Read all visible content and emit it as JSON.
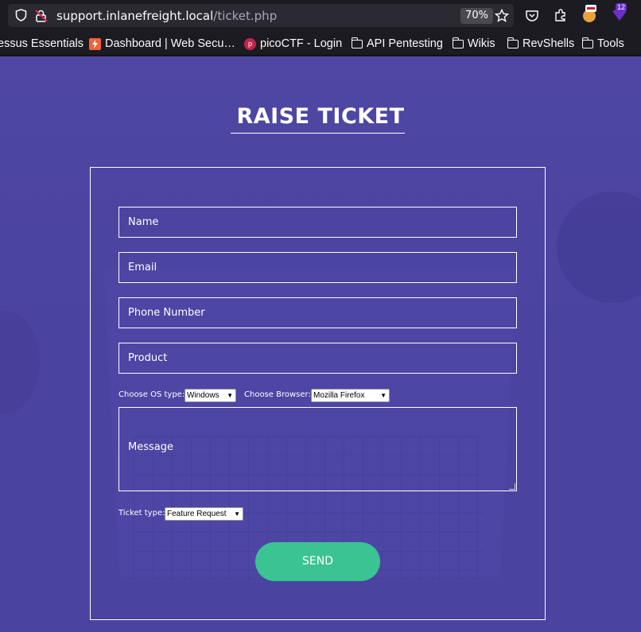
{
  "browser": {
    "url_host": "support.inlanefreight.local",
    "url_path": "/ticket.php",
    "zoom": "70%",
    "badge_count": "12"
  },
  "bookmarks": [
    {
      "label": "essus Essentials",
      "icon": "none"
    },
    {
      "label": "Dashboard | Web Secu…",
      "icon": "lightning-icon"
    },
    {
      "label": "picoCTF - Login",
      "icon": "picoctf-icon"
    },
    {
      "label": "API Pentesting",
      "icon": "folder-icon"
    },
    {
      "label": "Wikis",
      "icon": "folder-icon"
    },
    {
      "label": "RevShells",
      "icon": "folder-icon"
    },
    {
      "label": "Tools",
      "icon": "folder-icon"
    }
  ],
  "form": {
    "title": "RAISE TICKET",
    "name_placeholder": "Name",
    "email_placeholder": "Email",
    "phone_placeholder": "Phone Number",
    "product_placeholder": "Product",
    "os_label": "Choose OS type:",
    "os_value": "Windows",
    "browser_label": "Choose Browser:",
    "browser_value": "Mozilla Firefox",
    "message_placeholder": "Message",
    "ticket_type_label": "Ticket type:",
    "ticket_type_value": "Feature Request",
    "send_label": "SEND"
  },
  "colors": {
    "page_bg": "#4b44a0",
    "send_button": "#3cc394",
    "browser_chrome": "#1c1b22"
  }
}
